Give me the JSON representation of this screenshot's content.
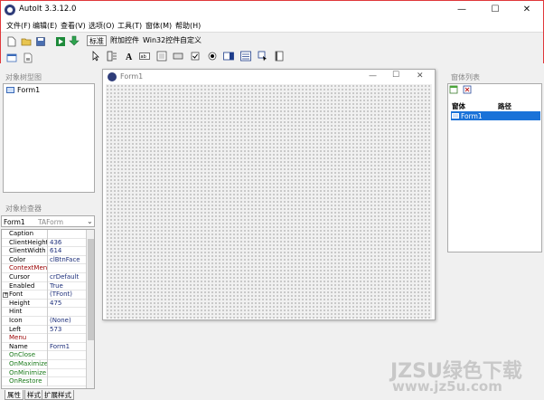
{
  "window": {
    "title": "AutoIt 3.3.12.0",
    "minimize": "—",
    "maximize": "☐",
    "close": "✕"
  },
  "menu": [
    "文件(F)",
    "编辑(E)",
    "查看(V)",
    "选项(O)",
    "工具(T)",
    "窗体(M)",
    "帮助(H)"
  ],
  "palette_tabs": [
    "标准",
    "附加控件",
    "Win32控件",
    "自定义"
  ],
  "tree_panel": {
    "caption": "对象树型图",
    "item": "Form1"
  },
  "inspector": {
    "caption": "对象检查器",
    "object_name": "Form1",
    "object_type": "TAForm",
    "properties": [
      {
        "name": "Caption",
        "value": "",
        "color": "#000000"
      },
      {
        "name": "ClientHeight",
        "value": "436",
        "color": "#000000"
      },
      {
        "name": "ClientWidth",
        "value": "614",
        "color": "#000000"
      },
      {
        "name": "Color",
        "value": "clBtnFace",
        "color": "#000000"
      },
      {
        "name": "ContextMenu",
        "value": "",
        "color": "#9a0000"
      },
      {
        "name": "Cursor",
        "value": "crDefault",
        "color": "#000000"
      },
      {
        "name": "Enabled",
        "value": "True",
        "color": "#000000"
      },
      {
        "name": "Font",
        "value": "(TFont)",
        "color": "#000000"
      },
      {
        "name": "Height",
        "value": "475",
        "color": "#000000"
      },
      {
        "name": "Hint",
        "value": "",
        "color": "#000000"
      },
      {
        "name": "Icon",
        "value": "(None)",
        "color": "#000000"
      },
      {
        "name": "Left",
        "value": "573",
        "color": "#000000"
      },
      {
        "name": "Menu",
        "value": "",
        "color": "#9a0000"
      },
      {
        "name": "Name",
        "value": "Form1",
        "color": "#000000"
      },
      {
        "name": "OnClose",
        "value": "",
        "color": "#1a7a1a"
      },
      {
        "name": "OnMaximize",
        "value": "",
        "color": "#1a7a1a"
      },
      {
        "name": "OnMinimize",
        "value": "",
        "color": "#1a7a1a"
      },
      {
        "name": "OnRestore",
        "value": "",
        "color": "#1a7a1a"
      }
    ],
    "tabs": [
      "属性",
      "样式",
      "扩展样式"
    ]
  },
  "form_designer": {
    "title": "Form1",
    "minimize": "—",
    "maximize": "☐",
    "close": "✕"
  },
  "window_list": {
    "caption": "窗体列表",
    "col_window": "窗体",
    "col_path": "路径",
    "row": "Form1",
    "row_bg": "#1a72d8"
  },
  "watermark": {
    "line1": "JZSU绿色下载",
    "line2": "www.jz5u.com"
  }
}
